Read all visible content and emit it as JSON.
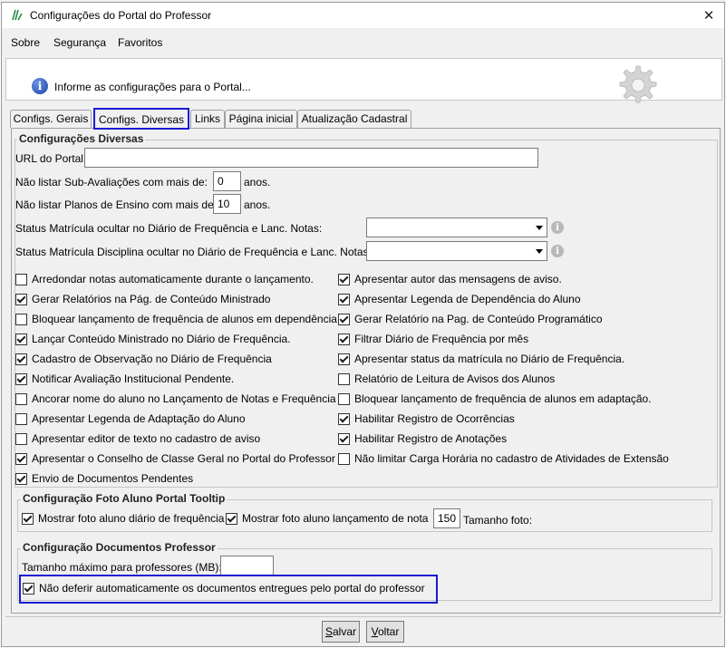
{
  "window": {
    "title": "Configurações do Portal do Professor",
    "close_glyph": "✕"
  },
  "menu": {
    "items": [
      {
        "label": "Sobre"
      },
      {
        "label": "Segurança"
      },
      {
        "label": "Favoritos"
      }
    ]
  },
  "info": {
    "icon_glyph": "i",
    "text": "Informe as configurações para o Portal..."
  },
  "tabs": [
    {
      "label": "Configs. Gerais",
      "active": false
    },
    {
      "label": "Configs. Diversas",
      "active": true
    },
    {
      "label": "Links",
      "active": false
    },
    {
      "label": "Página inicial",
      "active": false
    },
    {
      "label": "Atualização Cadastral",
      "active": false
    }
  ],
  "diversas": {
    "legend": "Configurações Diversas",
    "url_label": "URL do Portal:",
    "url_value": "",
    "sub_aval_label": "Não listar Sub-Avaliações com mais de:",
    "sub_aval_value": "0",
    "sub_aval_unit": "anos.",
    "planos_label": "Não listar Planos de Ensino com mais de:",
    "planos_value": "10",
    "planos_unit": "anos.",
    "status_freq_label": "Status Matrícula ocultar no Diário de Frequência e Lanc. Notas:",
    "status_freq_value": "",
    "status_disc_label": "Status Matrícula Disciplina ocultar no Diário de Frequência e Lanc. Notas:",
    "status_disc_value": "",
    "help_glyph": "i",
    "checkboxes_left": [
      {
        "label": "Arredondar notas automaticamente durante o lançamento.",
        "checked": false
      },
      {
        "label": "Gerar Relatórios na Pág. de Conteúdo Ministrado",
        "checked": true
      },
      {
        "label": "Bloquear lançamento de frequência de alunos em dependência.",
        "checked": false
      },
      {
        "label": "Lançar Conteúdo Ministrado no Diário de Frequência.",
        "checked": true
      },
      {
        "label": "Cadastro de Observação no Diário de Frequência",
        "checked": true
      },
      {
        "label": "Notificar Avaliação Institucional Pendente.",
        "checked": true
      },
      {
        "label": "Ancorar nome do aluno no Lançamento de Notas e Frequência",
        "checked": false
      },
      {
        "label": "Apresentar Legenda de Adaptação do Aluno",
        "checked": false
      },
      {
        "label": "Apresentar editor de texto no cadastro de aviso",
        "checked": false
      },
      {
        "label": "Apresentar o Conselho de Classe Geral no Portal do Professor",
        "checked": true
      },
      {
        "label": "Envio de Documentos Pendentes",
        "checked": true
      }
    ],
    "checkboxes_right": [
      {
        "label": "Apresentar autor das mensagens de aviso.",
        "checked": true
      },
      {
        "label": "Apresentar Legenda de Dependência do Aluno",
        "checked": true
      },
      {
        "label": "Gerar Relatório na Pag. de Conteúdo Programático",
        "checked": true
      },
      {
        "label": "Filtrar Diário de Frequência por mês",
        "checked": true
      },
      {
        "label": "Apresentar status da matrícula no Diário de Frequência.",
        "checked": true
      },
      {
        "label": "Relatório de Leitura de Avisos dos Alunos",
        "checked": false
      },
      {
        "label": "Bloquear lançamento de frequência de alunos em adaptação.",
        "checked": false
      },
      {
        "label": "Habilitar Registro de Ocorrências",
        "checked": true
      },
      {
        "label": "Habilitar Registro de Anotações",
        "checked": true
      },
      {
        "label": "Não limitar Carga Horária no cadastro de Atividades de Extensão",
        "checked": false
      }
    ]
  },
  "foto": {
    "legend": "Configuração Foto Aluno Portal Tooltip",
    "diario_label": "Mostrar foto aluno diário de frequência",
    "diario_checked": true,
    "lancamento_label": "Mostrar foto aluno lançamento de nota",
    "lancamento_checked": true,
    "tamanho_value": "150",
    "tamanho_label": "Tamanho foto:"
  },
  "documentos": {
    "legend": "Configuração Documentos Professor",
    "tamanho_label": "Tamanho máximo para professores (MB):",
    "tamanho_value": "",
    "nao_deferir_label": "Não deferir automaticamente os documentos entregues pelo portal do professor",
    "nao_deferir_checked": true
  },
  "buttons": {
    "salvar": {
      "first": "S",
      "rest": "alvar"
    },
    "voltar": {
      "first": "V",
      "rest": "oltar"
    }
  },
  "colors": {
    "highlight": "#1a1ad4",
    "window_bg": "#f0f0f0"
  }
}
